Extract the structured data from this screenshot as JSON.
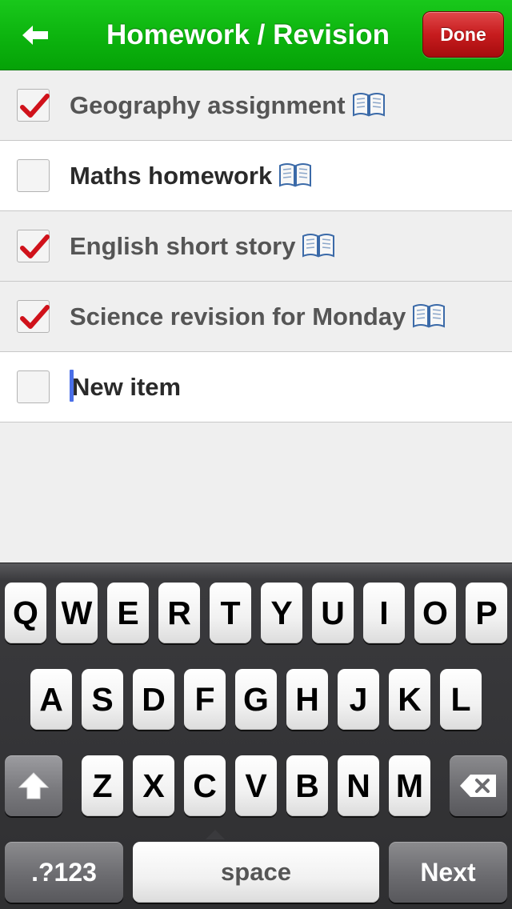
{
  "navbar": {
    "back_icon": "left-arrow-icon",
    "title": "Homework / Revision",
    "done_label": "Done"
  },
  "list": {
    "items": [
      {
        "label": "Geography assignment",
        "checked": true,
        "icon": "book-icon"
      },
      {
        "label": "Maths homework",
        "checked": false,
        "icon": "book-icon"
      },
      {
        "label": "English short story",
        "checked": true,
        "icon": "book-icon"
      },
      {
        "label": "Science revision for Monday",
        "checked": true,
        "icon": "book-icon"
      }
    ],
    "new_item_placeholder": "New item"
  },
  "keyboard": {
    "row1": [
      "Q",
      "W",
      "E",
      "R",
      "T",
      "Y",
      "U",
      "I",
      "O",
      "P"
    ],
    "row2": [
      "A",
      "S",
      "D",
      "F",
      "G",
      "H",
      "J",
      "K",
      "L"
    ],
    "row3": [
      "Z",
      "X",
      "C",
      "V",
      "B",
      "N",
      "M"
    ],
    "numbers_label": ".?123",
    "space_label": "space",
    "next_label": "Next",
    "shift_icon": "shift-arrow-icon",
    "delete_icon": "backspace-icon"
  },
  "colors": {
    "navbar_green": "#0cb30e",
    "done_red": "#c71c1e",
    "check_red": "#d0121b",
    "caret_blue": "#4a6fe8"
  }
}
